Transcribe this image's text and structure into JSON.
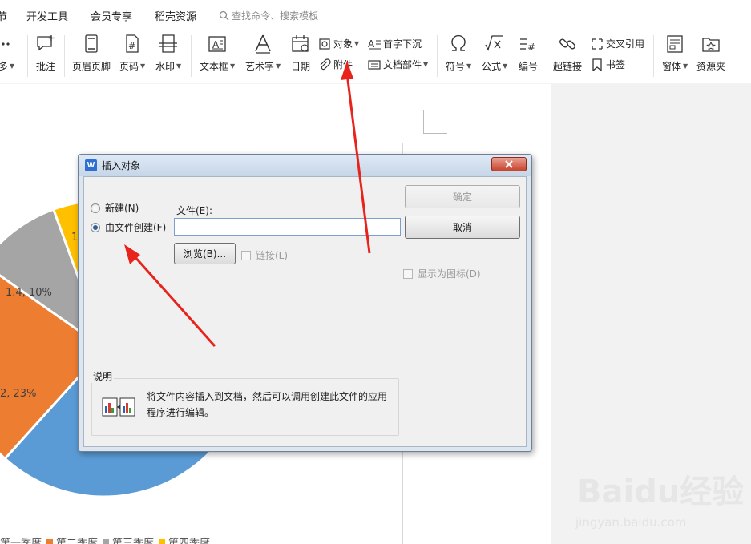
{
  "menubar": {
    "items": [
      "节",
      "开发工具",
      "会员专享",
      "稻壳资源"
    ],
    "search_placeholder": "查找命令、搜索模板"
  },
  "ribbon": {
    "more_label": "更多",
    "comment_label": "批注",
    "header_footer_label": "页眉页脚",
    "page_number_label": "页码",
    "watermark_label": "水印",
    "textbox_label": "文本框",
    "wordart_label": "艺术字",
    "date_label": "日期",
    "object_label": "对象",
    "attachment_label": "附件",
    "dropcap_label": "首字下沉",
    "docpart_label": "文档部件",
    "symbol_label": "符号",
    "formula_label": "公式",
    "numbering_label": "编号",
    "hyperlink_label": "超链接",
    "crossref_label": "交叉引用",
    "bookmark_label": "书签",
    "window_label": "窗体",
    "resource_label": "资源夹"
  },
  "dialog": {
    "title": "插入对象",
    "radio_new": "新建(N)",
    "radio_from_file": "由文件创建(F)",
    "file_label": "文件(E):",
    "file_value": "",
    "browse_button": "浏览(B)...",
    "link_checkbox": "链接(L)",
    "ok_button": "确定",
    "cancel_button": "取消",
    "display_as_icon": "显示为图标(D)",
    "desc_title": "说明",
    "desc_text": "将文件内容插入到文档，然后可以调用创建此文件的应用程序进行编辑。"
  },
  "chart_data": {
    "type": "pie",
    "labels_visible": [
      "1.4, 10%",
      "2, 23%",
      "1"
    ],
    "legend": [
      "第一季度",
      "第二季度",
      "第三季度",
      "第四季度"
    ],
    "colors": [
      "#5b9bd5",
      "#ed7d31",
      "#a5a5a5",
      "#ffc000"
    ]
  },
  "watermark": {
    "brand": "Baidu经验",
    "url": "jingyan.baidu.com"
  }
}
